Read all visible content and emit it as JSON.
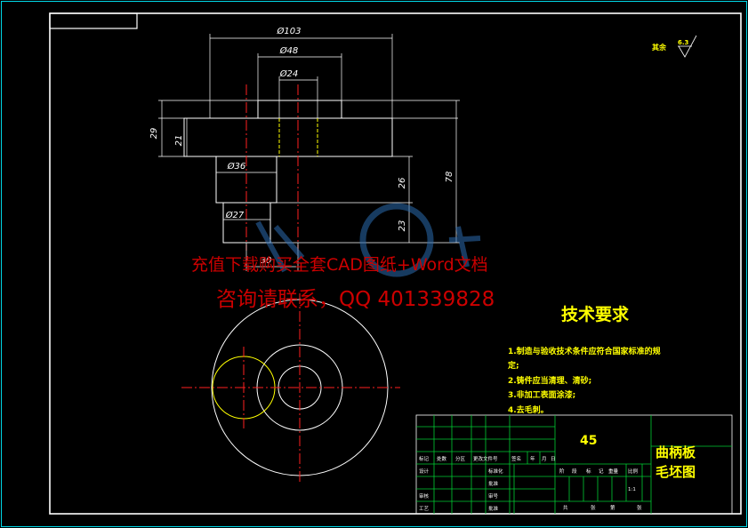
{
  "dimensions": {
    "d103": "Ø103",
    "d48": "Ø48",
    "d24": "Ø24",
    "d36": "Ø36",
    "d27": "Ø27",
    "h29": "29",
    "h21": "21",
    "h26": "26",
    "h78": "78",
    "h23": "23",
    "w30": "30"
  },
  "surface_finish": {
    "label": "其余",
    "value": "6.3"
  },
  "watermark": {
    "line1": "充值下载购买全套CAD图纸+Word文档",
    "line2": "咨询请联系，QQ 401339828"
  },
  "requirements": {
    "title": "技术要求",
    "items": [
      "1.制造与验收技术条件应符合国家标准的规",
      "定;",
      "2.铸件应当清理、清砂;",
      "3.非加工表面涂漆;",
      "4.去毛刺。"
    ]
  },
  "title_block": {
    "material": "45",
    "part_name_line1": "曲柄板",
    "part_name_line2": "毛坯图",
    "scale": "1:1",
    "header_cells": [
      "标记",
      "处数",
      "分区",
      "更改文件号",
      "签名",
      "年",
      "月",
      "日"
    ],
    "role_labels": [
      "设计",
      "审核",
      "工艺"
    ],
    "std_labels": [
      "标准化",
      "批准",
      "审号",
      "批准"
    ],
    "stage_labels": [
      "阶",
      "段",
      "标",
      "记",
      "重量",
      "比例"
    ],
    "sheet_labels": [
      "共",
      "张",
      "第",
      "张"
    ]
  }
}
